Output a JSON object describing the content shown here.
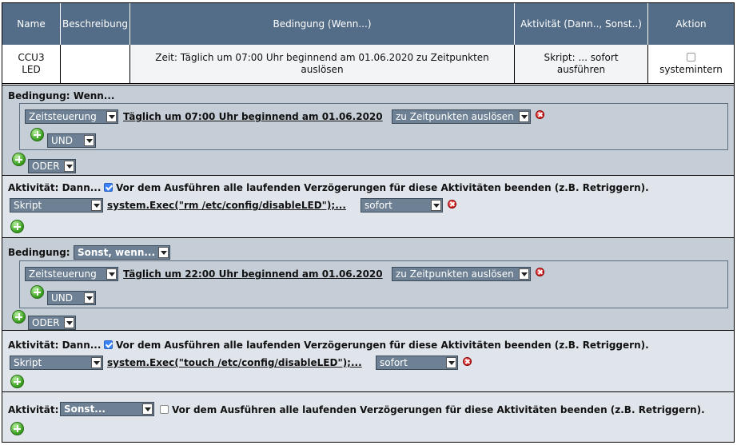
{
  "table": {
    "headers": [
      "Name",
      "Beschreibung",
      "Bedingung (Wenn...)",
      "Aktivität (Dann.., Sonst..)",
      "Aktion"
    ],
    "row": {
      "name_line1": "CCU3",
      "name_line2": "LED",
      "beschreibung": "",
      "bedingung": "Zeit: Täglich um 07:00 Uhr beginnend am 01.06.2020 zu Zeitpunkten auslösen",
      "aktivitaet": "Skript: ... sofort ausführen",
      "aktion_label": "systemintern"
    }
  },
  "if1": {
    "label": "Bedingung: Wenn...",
    "type_select": "Zeitsteuerung",
    "time_link": "Täglich um 07:00 Uhr beginnend am 01.06.2020",
    "trigger_select": "zu Zeitpunkten auslösen",
    "and_select": "UND",
    "or_select": "ODER"
  },
  "then1": {
    "label": "Aktivität: Dann...",
    "checkbox_checked": true,
    "checkbox_text": "Vor dem Ausführen alle laufenden Verzögerungen für diese Aktivitäten beenden (z.B. Retriggern).",
    "type_select": "Skript",
    "script_link": "system.Exec(\"rm /etc/config/disableLED\");...",
    "timing_select": "sofort"
  },
  "else_if": {
    "label": "Bedingung:",
    "mode_select": "Sonst, wenn...",
    "type_select": "Zeitsteuerung",
    "time_link": "Täglich um 22:00 Uhr beginnend am 01.06.2020",
    "trigger_select": "zu Zeitpunkten auslösen",
    "and_select": "UND",
    "or_select": "ODER"
  },
  "then2": {
    "label": "Aktivität: Dann...",
    "checkbox_checked": true,
    "checkbox_text": "Vor dem Ausführen alle laufenden Verzögerungen für diese Aktivitäten beenden (z.B. Retriggern).",
    "type_select": "Skript",
    "script_link": "system.Exec(\"touch /etc/config/disableLED\");...",
    "timing_select": "sofort"
  },
  "else": {
    "label": "Aktivität:",
    "mode_select": "Sonst...",
    "checkbox_checked": false,
    "checkbox_text": "Vor dem Ausführen alle laufenden Verzögerungen für diese Aktivitäten beenden (z.B. Retriggern)."
  },
  "colors": {
    "header_bg": "#536d88",
    "section_gray": "#c5ced7",
    "section_light": "#dfe5eb",
    "select_bg": "#6e8194",
    "checkbox_blue": "#3b82f6"
  },
  "icons": [
    "add-icon",
    "delete-icon",
    "dropdown-arrow-icon",
    "checkbox-icon"
  ]
}
